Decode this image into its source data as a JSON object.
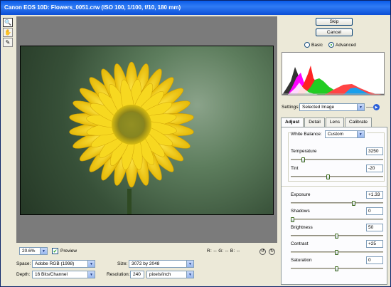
{
  "window": {
    "title": "Canon EOS 10D:  Flowers_0051.crw  (ISO 100, 1/100, f/10, 180 mm)"
  },
  "tools": [
    {
      "name": "zoom-tool-icon",
      "glyph": "🔍"
    },
    {
      "name": "hand-tool-icon",
      "glyph": "✋"
    },
    {
      "name": "white-balance-tool-icon",
      "glyph": "✎"
    }
  ],
  "bottom": {
    "zoom_value": "20.6%",
    "preview_label": "Preview",
    "rgb_readout": "R: -- G: -- B: --",
    "space_label": "Space:",
    "space_value": "Adobe RGB (1998)",
    "depth_label": "Depth:",
    "depth_value": "16 Bits/Channel",
    "size_label": "Size:",
    "size_value": "3072 by 2048",
    "resolution_label": "Resolution:",
    "resolution_value": "240",
    "resolution_unit": "pixels/inch"
  },
  "right": {
    "skip_label": "Skip",
    "cancel_label": "Cancel",
    "basic_label": "Basic",
    "advanced_label": "Advanced",
    "settings_label": "Settings:",
    "settings_value": "Selected Image",
    "tabs": [
      "Adjust",
      "Detail",
      "Lens",
      "Calibrate"
    ],
    "white_balance_label": "White Balance:",
    "white_balance_value": "Custom",
    "sliders": [
      {
        "label": "Temperature",
        "value": "3250",
        "level": 0.12
      },
      {
        "label": "Tint",
        "value": "-20",
        "level": 0.4
      },
      {
        "label": "Exposure",
        "value": "+1.33",
        "level": 0.69
      },
      {
        "label": "Shadows",
        "value": "0",
        "level": 0.0
      },
      {
        "label": "Brightness",
        "value": "50",
        "level": 0.5
      },
      {
        "label": "Contrast",
        "value": "+25",
        "level": 0.5
      },
      {
        "label": "Saturation",
        "value": "0",
        "level": 0.5
      }
    ]
  },
  "colors": {
    "titlebar": "#0c4fd6",
    "window": "#ece9d8",
    "canvas": "#7b7b7b",
    "flower": "#f5d11a"
  }
}
